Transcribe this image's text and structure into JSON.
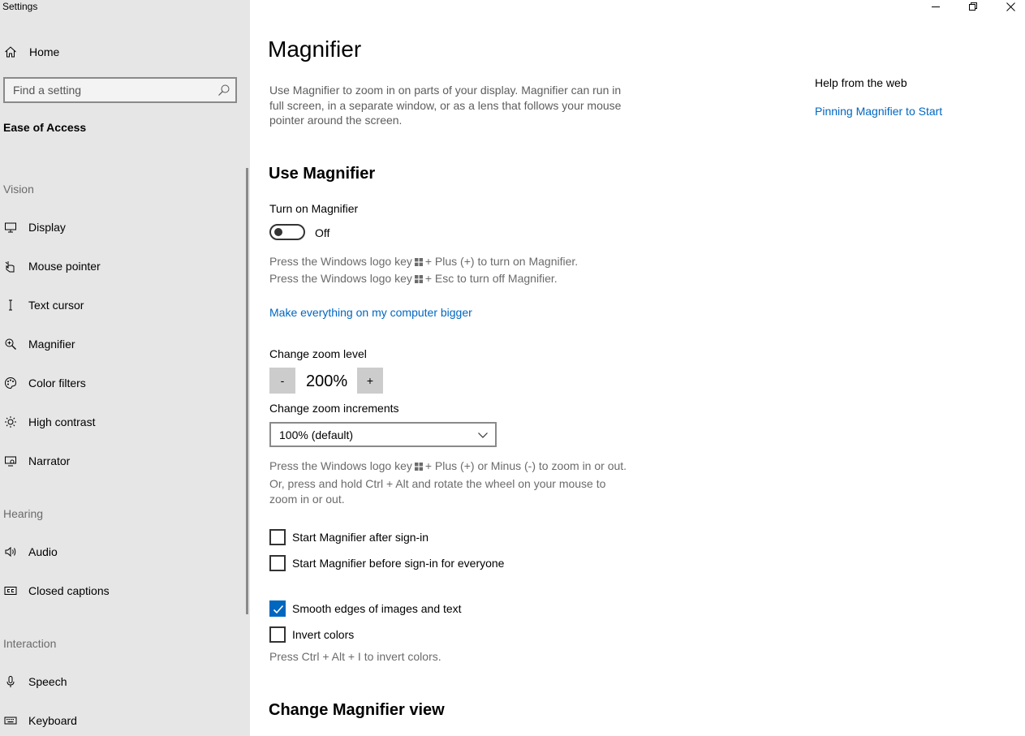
{
  "window": {
    "title": "Settings"
  },
  "sidebar": {
    "home_label": "Home",
    "search_placeholder": "Find a setting",
    "current_section": "Ease of Access",
    "groups": {
      "vision": "Vision",
      "hearing": "Hearing",
      "interaction": "Interaction"
    },
    "items": [
      {
        "label": "Display",
        "icon": "display-icon"
      },
      {
        "label": "Mouse pointer",
        "icon": "mouse-pointer-icon"
      },
      {
        "label": "Text cursor",
        "icon": "text-cursor-icon"
      },
      {
        "label": "Magnifier",
        "icon": "magnifier-icon"
      },
      {
        "label": "Color filters",
        "icon": "color-filters-icon"
      },
      {
        "label": "High contrast",
        "icon": "high-contrast-icon"
      },
      {
        "label": "Narrator",
        "icon": "narrator-icon"
      },
      {
        "label": "Audio",
        "icon": "audio-icon"
      },
      {
        "label": "Closed captions",
        "icon": "closed-captions-icon"
      },
      {
        "label": "Speech",
        "icon": "microphone-icon"
      },
      {
        "label": "Keyboard",
        "icon": "keyboard-icon"
      }
    ]
  },
  "main": {
    "title": "Magnifier",
    "description": "Use Magnifier to zoom in on parts of your display. Magnifier can run in full screen, in a separate window, or as a lens that follows your mouse pointer around the screen.",
    "use_magnifier": {
      "heading": "Use Magnifier",
      "toggle_label": "Turn on Magnifier",
      "toggle_state": "Off",
      "toggle_on": false,
      "shortcut_on_before": "Press the Windows logo key",
      "shortcut_on_after": "+ Plus (+) to turn on Magnifier.",
      "shortcut_off_before": "Press the Windows logo key",
      "shortcut_off_after": "+ Esc to turn off Magnifier.",
      "bigger_link": "Make everything on my computer bigger"
    },
    "zoom": {
      "level_label": "Change zoom level",
      "minus": "-",
      "value": "200%",
      "plus": "+",
      "increments_label": "Change zoom increments",
      "increment_selected": "100% (default)",
      "hint_line1_before": "Press the Windows logo key",
      "hint_line1_after": "+ Plus (+) or Minus (-) to zoom in or out.",
      "hint_line2": "Or, press and hold Ctrl + Alt and rotate the wheel on your mouse to",
      "hint_line3": "zoom in or out."
    },
    "options": {
      "start_after_signin": "Start Magnifier after sign-in",
      "start_before_signin": "Start Magnifier before sign-in for everyone",
      "smooth_edges": "Smooth edges of images and text",
      "invert_colors": "Invert colors",
      "invert_hint": "Press Ctrl + Alt + I to invert colors.",
      "checked": {
        "start_after_signin": false,
        "start_before_signin": false,
        "smooth_edges": true,
        "invert_colors": false
      }
    },
    "view_heading": "Change Magnifier view"
  },
  "help": {
    "title": "Help from the web",
    "link": "Pinning Magnifier to Start"
  },
  "colors": {
    "accent": "#0067c0",
    "sidebar_bg": "#e6e6e6"
  }
}
